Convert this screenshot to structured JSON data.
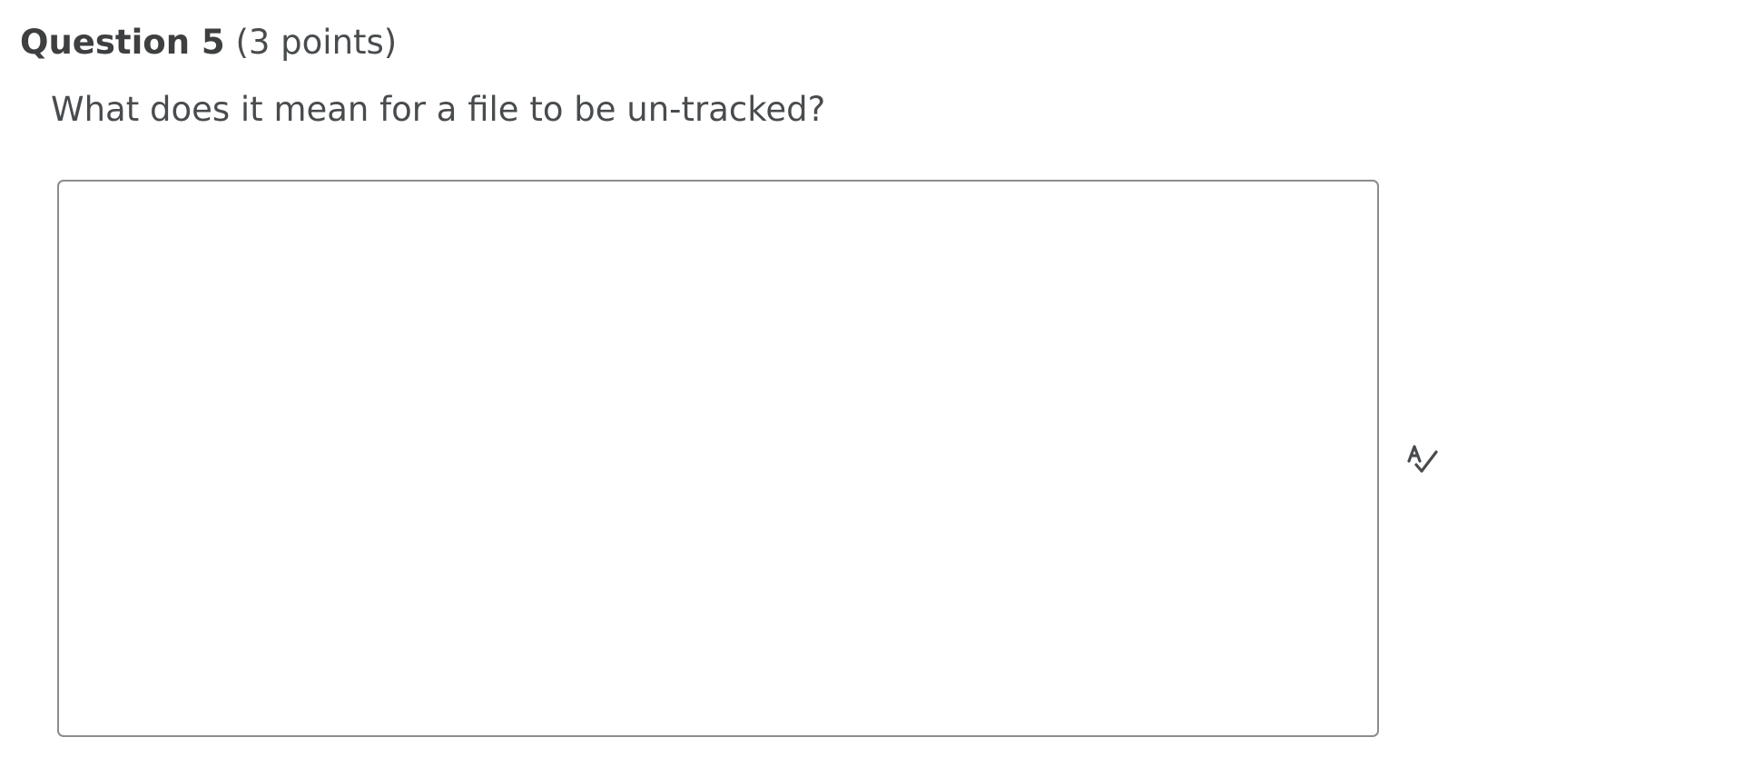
{
  "question": {
    "title": "Question 5",
    "points": "(3 points)",
    "text": "What does it mean for a file to be un-tracked?"
  },
  "answer": {
    "value": ""
  },
  "icons": {
    "spellcheck": "spellcheck-icon"
  },
  "colors": {
    "text": "#494c4e",
    "title": "#3d3f41",
    "border": "#8a8c8e",
    "icon": "#494c4e"
  }
}
